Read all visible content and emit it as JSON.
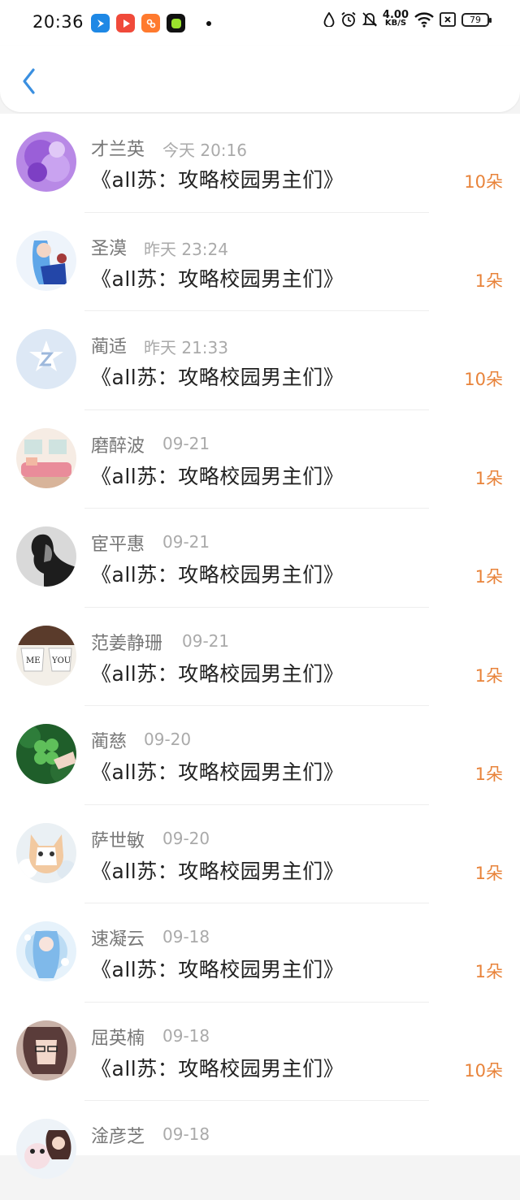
{
  "status_bar": {
    "time": "20:36",
    "net_speed_value": "4.00",
    "net_speed_unit": "KB/S",
    "battery": "79",
    "icons": [
      "app-blue-icon",
      "app-red-play-icon",
      "app-orange-icon",
      "app-green-icon",
      "water-drop-icon",
      "alarm-icon",
      "mute-icon",
      "wifi-icon",
      "sim-x-icon",
      "battery-icon"
    ]
  },
  "header": {
    "back_icon": "chevron-left-icon",
    "accent_color": "#3a8fe0"
  },
  "colors": {
    "count": "#e8833a",
    "name": "#777777",
    "time": "#aaaaaa"
  },
  "items": [
    {
      "name": "才兰英",
      "time": "今天 20:16",
      "book": "《all苏：攻略校园男主们》",
      "count": "10朵"
    },
    {
      "name": "圣漠",
      "time": "昨天 23:24",
      "book": "《all苏：攻略校园男主们》",
      "count": "1朵"
    },
    {
      "name": "蔺适",
      "time": "昨天 21:33",
      "book": "《all苏：攻略校园男主们》",
      "count": "10朵"
    },
    {
      "name": "磨醉波",
      "time": "09-21",
      "book": "《all苏：攻略校园男主们》",
      "count": "1朵"
    },
    {
      "name": "宦平惠",
      "time": "09-21",
      "book": "《all苏：攻略校园男主们》",
      "count": "1朵"
    },
    {
      "name": "范姜静珊",
      "time": "09-21",
      "book": "《all苏：攻略校园男主们》",
      "count": "1朵"
    },
    {
      "name": "蔺慈",
      "time": "09-20",
      "book": "《all苏：攻略校园男主们》",
      "count": "1朵"
    },
    {
      "name": "萨世敏",
      "time": "09-20",
      "book": "《all苏：攻略校园男主们》",
      "count": "1朵"
    },
    {
      "name": "速凝云",
      "time": "09-18",
      "book": "《all苏：攻略校园男主们》",
      "count": "1朵"
    },
    {
      "name": "屈英楠",
      "time": "09-18",
      "book": "《all苏：攻略校园男主们》",
      "count": "10朵"
    },
    {
      "name": "淦彦芝",
      "time": "09-18",
      "book": "",
      "count": ""
    }
  ],
  "mug_labels": {
    "left": "ME",
    "right": "YOU"
  }
}
